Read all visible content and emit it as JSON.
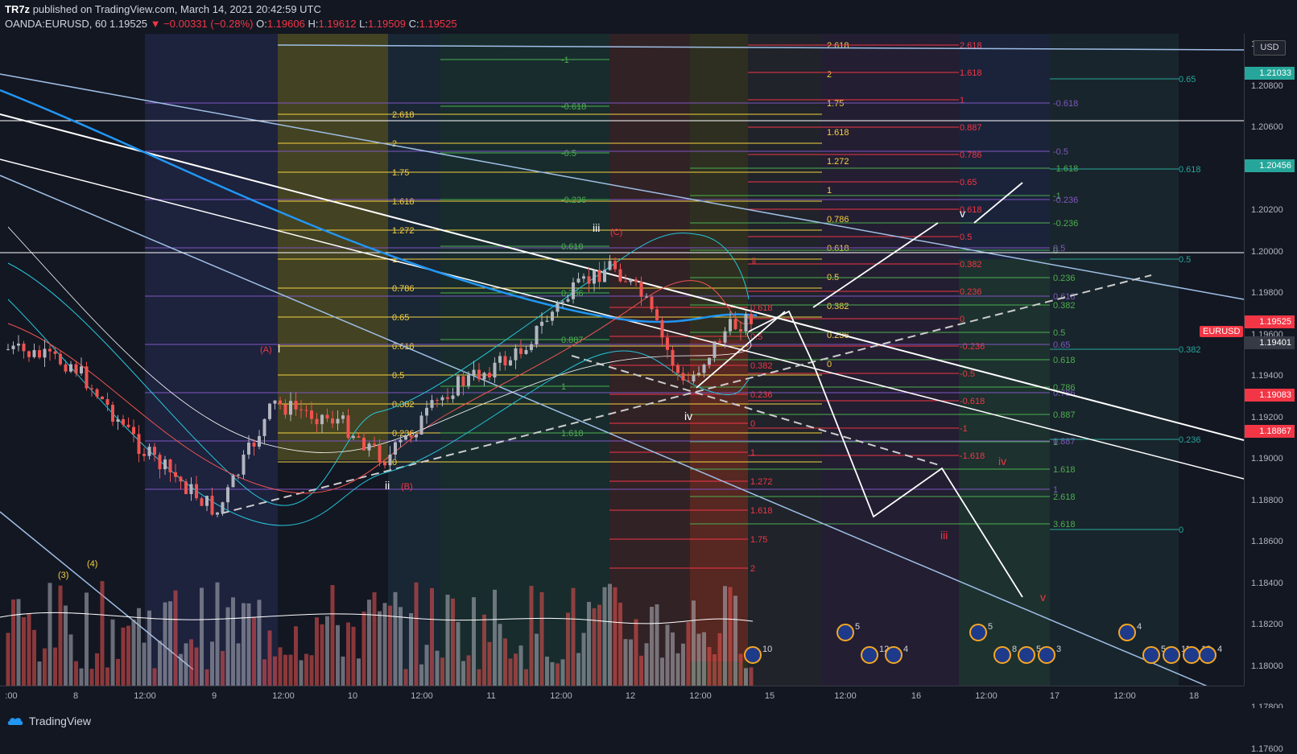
{
  "header": {
    "author": "TR7z",
    "published": "published on TradingView.com, March 14, 2021 20:42:59 UTC",
    "symbol": "OANDA:EURUSD, 60",
    "last": "1.19525",
    "arrow": "▼",
    "change": "−0.00331 (−0.28%)",
    "o_label": "O:",
    "o_value": "1.19606",
    "h_label": "H:",
    "h_value": "1.19612",
    "l_label": "L:",
    "l_value": "1.19509",
    "c_label": "C:",
    "c_value": "1.19525"
  },
  "price_axis": {
    "currency": "USD",
    "ticks": [
      "1.21000",
      "1.20800",
      "1.20600",
      "1.20400",
      "1.20200",
      "1.20000",
      "1.19800",
      "1.19600",
      "1.19400",
      "1.19200",
      "1.19000",
      "1.18800",
      "1.18600",
      "1.18400",
      "1.18200",
      "1.18000",
      "1.17800",
      "1.17600"
    ],
    "tags": [
      {
        "value": "1.21033",
        "color": "#26a69a"
      },
      {
        "value": "1.20456",
        "color": "#26a69a"
      },
      {
        "value": "1.19525",
        "color": "#f23645"
      },
      {
        "value": "1.19401",
        "color": "#363a45"
      },
      {
        "value": "1.19083",
        "color": "#f23645"
      },
      {
        "value": "1.18867",
        "color": "#f23645"
      }
    ],
    "series_label": "EURUSD"
  },
  "time_axis": {
    "ticks": [
      ":00",
      "8",
      "12:00",
      "9",
      "12:00",
      "10",
      "12:00",
      "11",
      "12:00",
      "12",
      "12:00",
      "15",
      "12:00",
      "16",
      "12:00",
      "17",
      "12:00",
      "18"
    ]
  },
  "wave_labels": {
    "i": "i",
    "ii": "ii",
    "iii": "iii",
    "iv": "iv",
    "v": "v",
    "A": "(A)",
    "B": "(B)",
    "C": "(C)",
    "three": "(3)",
    "four": "(4)",
    "red_iii": "iii",
    "red_iv": "iv",
    "red_v": "v",
    "red_ii": "ii"
  },
  "fib_yellow_left": [
    "2.618",
    "2",
    "1.75",
    "1.618",
    "1.272",
    "1",
    "0.786",
    "0.65",
    "0.618",
    "0.5",
    "0.382",
    "0.236",
    "0"
  ],
  "fib_yellow_right": [
    "2.618",
    "2",
    "1.75",
    "1.618",
    "1.272",
    "1",
    "0.786",
    "0.618",
    "0.5",
    "0.382",
    "0.236",
    "0"
  ],
  "fib_red_right": [
    "2.618",
    "1.618",
    "1",
    "0.887",
    "0.786",
    "0.65",
    "0.618",
    "0.5",
    "0.382",
    "0.236",
    "0",
    "-0.236",
    "-0.5",
    "-0.618",
    "-1",
    "-1.618"
  ],
  "fib_green_right": [
    "-1.618",
    "-1",
    "-0.236",
    "0",
    "0.236",
    "0.382",
    "0.5",
    "0.618",
    "0.786",
    "0.887",
    "1",
    "1.618",
    "2.618",
    "3.618"
  ],
  "fib_purple_right": [
    "-0.618",
    "-0.5",
    "-0.236",
    "0.5",
    "0.618",
    "0.65",
    "0.786",
    "0.887",
    "1"
  ],
  "fib_teal_far": [
    "0.65",
    "0.618",
    "0.5",
    "0.382",
    "0.236",
    "0"
  ],
  "fib_red_mid": [
    "0.618",
    "0.5",
    "0.382",
    "0.236",
    "0",
    "1",
    "1.272",
    "1.618",
    "1.75",
    "2"
  ],
  "fib_green_mid": [
    "-1",
    "-0.618",
    "-0.5",
    "-0.236",
    "0.618",
    "0.786",
    "0.887",
    "1",
    "1.618"
  ],
  "event_badges": [
    "5",
    "12",
    "4",
    "5",
    "8",
    "5",
    "3",
    "4",
    "5",
    "11",
    "12",
    "4",
    "10"
  ],
  "footer": {
    "brand": "TradingView"
  },
  "colors": {
    "bg": "#131722",
    "up": "#b2b5be",
    "down": "#ef5350",
    "yellow": "#f5d142",
    "red": "#f23645",
    "green": "#4caf50",
    "purple": "#7e57c2",
    "teal": "#26a69a",
    "blue": "#2196f3"
  }
}
